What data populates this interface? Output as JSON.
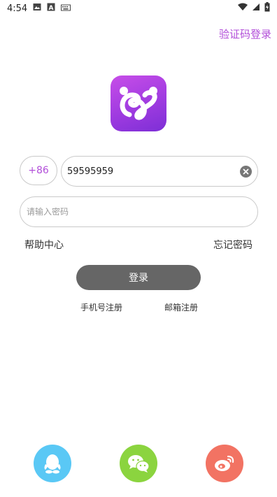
{
  "status_bar": {
    "time": "4:54",
    "left_icons": [
      "image-icon",
      "text-a-icon",
      "keyboard-icon"
    ],
    "right_icons": [
      "wifi-icon",
      "signal-icon",
      "battery-charging-icon"
    ]
  },
  "header": {
    "code_login_link": "验证码登录"
  },
  "logo": {
    "icon": "app-logo-icon",
    "colors": [
      "#c74ee8",
      "#7d2fd6"
    ]
  },
  "form": {
    "country_code": "+86",
    "phone_value": "59595959",
    "password_placeholder": "请输入密码"
  },
  "links": {
    "help": "帮助中心",
    "forgot_password": "忘记密码"
  },
  "login_button": "登录",
  "register": {
    "phone": "手机号注册",
    "email": "邮箱注册"
  },
  "social": [
    {
      "name": "qq",
      "icon": "qq-icon",
      "color": "#5ac8f5"
    },
    {
      "name": "wechat",
      "icon": "wechat-icon",
      "color": "#8bd43f"
    },
    {
      "name": "weibo",
      "icon": "weibo-icon",
      "color": "#f27363"
    }
  ],
  "colors": {
    "accent": "#b24fd9",
    "button": "#666666",
    "border": "#c9c9c9"
  }
}
